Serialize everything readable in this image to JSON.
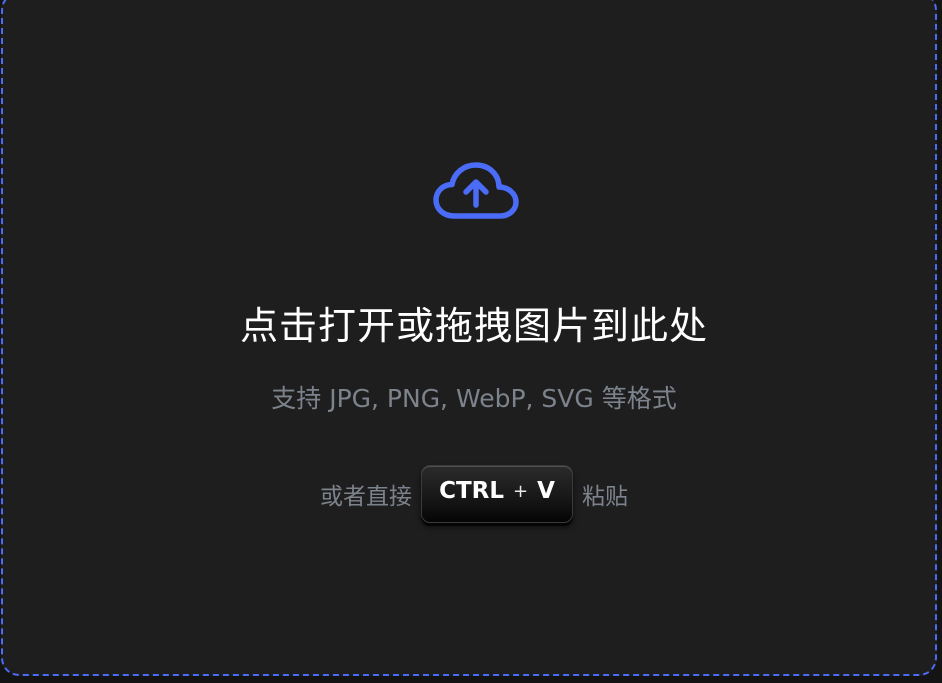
{
  "dropzone": {
    "icon": "cloud-upload-icon",
    "title": "点击打开或拖拽图片到此处",
    "formats_hint": "支持 JPG, PNG, WebP, SVG 等格式",
    "paste_prefix": "或者直接",
    "paste_suffix": "粘贴",
    "shortcut": {
      "modifier": "CTRL",
      "plus": "+",
      "key": "V"
    }
  },
  "colors": {
    "accent": "#4a6cf7",
    "background": "#1e1e1e",
    "title_text": "#ffffff",
    "muted_text": "#7d838c"
  }
}
